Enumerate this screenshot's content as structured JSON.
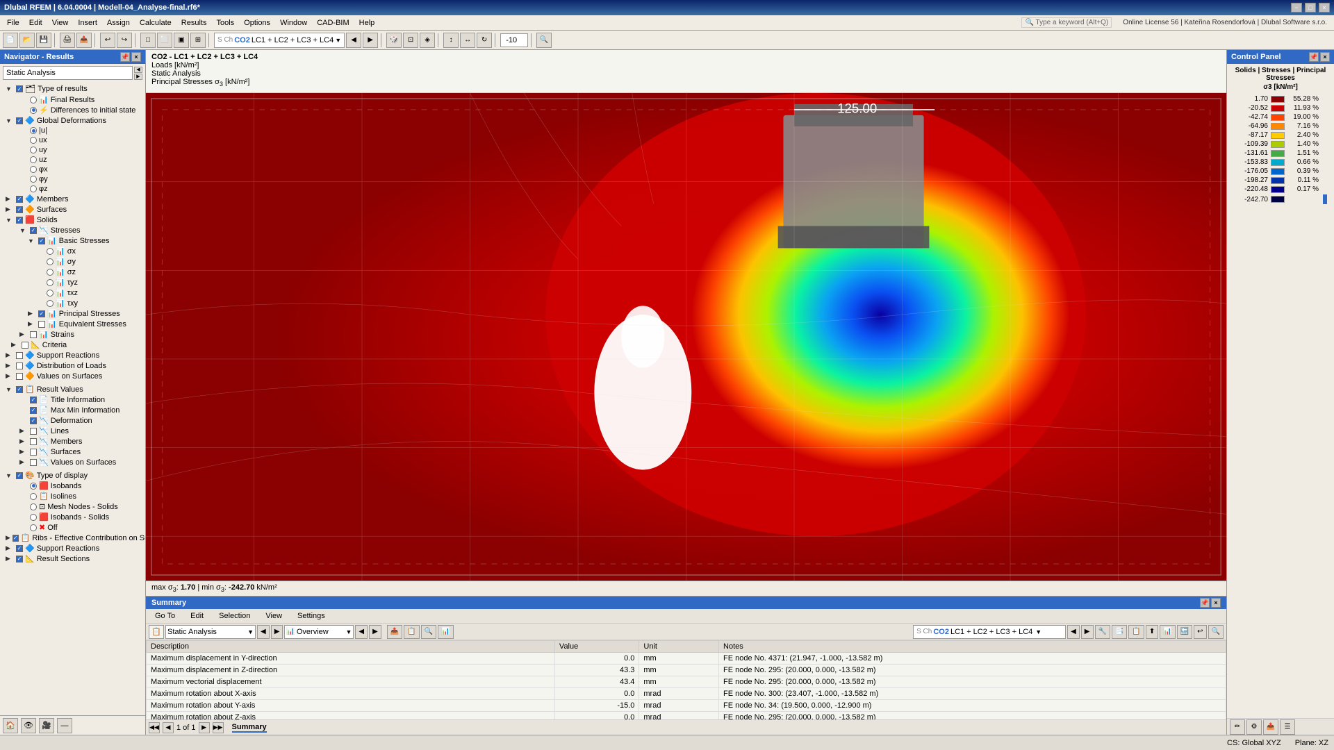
{
  "titlebar": {
    "title": "Dlubal RFEM | 6.04.0004 | Modell-04_Analyse-final.rf6*",
    "controls": [
      "−",
      "□",
      "×"
    ]
  },
  "menubar": {
    "items": [
      "File",
      "Edit",
      "View",
      "Insert",
      "Assign",
      "Calculate",
      "Results",
      "Tools",
      "Options",
      "Window",
      "CAD-BIM",
      "Help"
    ]
  },
  "navigator": {
    "title": "Navigator - Results",
    "combo": "Static Analysis",
    "tree": {
      "type_of_results": "Type of results",
      "final_results": "Final Results",
      "differences": "Differences to initial state",
      "global_deformations": "Global Deformations",
      "u": "|u|",
      "ux": "ux",
      "uy": "uy",
      "uz": "uz",
      "phi_x": "φx",
      "phi_y": "φy",
      "phi_z": "φz",
      "members": "Members",
      "surfaces": "Surfaces",
      "solids": "Solids",
      "stresses": "Stresses",
      "basic_stresses": "Basic Stresses",
      "sigma_x": "σx",
      "sigma_y": "σy",
      "sigma_z": "σz",
      "tau_yz": "τyz",
      "tau_xz": "τxz",
      "tau_xy": "τxy",
      "principal_stresses": "Principal Stresses",
      "equivalent_stresses": "Equivalent Stresses",
      "strains": "Strains",
      "criteria": "Criteria",
      "support_reactions": "Support Reactions",
      "distribution_of_loads": "Distribution of Loads",
      "values_on_surfaces": "Values on Surfaces",
      "result_values": "Result Values",
      "title_information": "Title Information",
      "max_min_information": "Max Min Information",
      "deformation": "Deformation",
      "lines": "Lines",
      "members2": "Members",
      "surfaces2": "Surfaces",
      "values_on_surfaces2": "Values on Surfaces",
      "type_of_display": "Type of display",
      "isobands": "Isobands",
      "isolines": "Isolines",
      "mesh_nodes_solids": "Mesh Nodes - Solids",
      "isobands_solids": "Isobands - Solids",
      "off": "Off",
      "ribs": "Ribs - Effective Contribution on Surfa...",
      "support_reactions2": "Support Reactions",
      "result_sections": "Result Sections"
    }
  },
  "infobar": {
    "line1": "CO2 - LC1 + LC2 + LC3 + LC4",
    "line2": "Loads [kN/m²]",
    "line3": "Static Analysis",
    "line4": "Principal Stresses σ3 [kN/m²]"
  },
  "viewport": {
    "max_label": "125.00"
  },
  "statusbar": {
    "text": "max σ3: 1.70 | min σ3: -242.70 kN/m²"
  },
  "control_panel": {
    "title": "Control Panel",
    "subtitle": "Solids | Stresses | Principal Stresses",
    "unit": "σ3 [kN/m²]",
    "legend": [
      {
        "value": "1.70",
        "pct": "55.28 %",
        "color": "#8b0000"
      },
      {
        "value": "-20.52",
        "pct": "11.93 %",
        "color": "#cc0000"
      },
      {
        "value": "-42.74",
        "pct": "19.00 %",
        "color": "#ff4400"
      },
      {
        "value": "-64.96",
        "pct": "7.16 %",
        "color": "#ff8800"
      },
      {
        "value": "-87.17",
        "pct": "2.40 %",
        "color": "#ffcc00"
      },
      {
        "value": "-109.39",
        "pct": "1.40 %",
        "color": "#aacc00"
      },
      {
        "value": "-131.61",
        "pct": "1.51 %",
        "color": "#44aa44"
      },
      {
        "value": "-153.83",
        "pct": "0.66 %",
        "color": "#00aacc"
      },
      {
        "value": "-176.05",
        "pct": "0.39 %",
        "color": "#0066cc"
      },
      {
        "value": "-198.27",
        "pct": "0.11 %",
        "color": "#0033aa"
      },
      {
        "value": "-220.48",
        "pct": "0.17 %",
        "color": "#000088"
      },
      {
        "value": "-242.70",
        "pct": "",
        "color": "#000044"
      }
    ]
  },
  "summary": {
    "title": "Summary",
    "tabs": [
      "Go To",
      "Edit",
      "Selection",
      "View",
      "Settings"
    ],
    "combo_analysis": "Static Analysis",
    "combo_overview": "Overview",
    "combo_lc": "S Ch  CO2   LC1 + LC2 + LC3 + LC4",
    "table": {
      "headers": [
        "Description",
        "Value",
        "Unit",
        "Notes"
      ],
      "rows": [
        {
          "desc": "Maximum displacement in Y-direction",
          "value": "0.0",
          "unit": "mm",
          "notes": "FE node No. 4371: (21.947, -1.000, -13.582 m)"
        },
        {
          "desc": "Maximum displacement in Z-direction",
          "value": "43.3",
          "unit": "mm",
          "notes": "FE node No. 295: (20.000, 0.000, -13.582 m)"
        },
        {
          "desc": "Maximum vectorial displacement",
          "value": "43.4",
          "unit": "mm",
          "notes": "FE node No. 295: (20.000, 0.000, -13.582 m)"
        },
        {
          "desc": "Maximum rotation about X-axis",
          "value": "0.0",
          "unit": "mrad",
          "notes": "FE node No. 300: (23.407, -1.000, -13.582 m)"
        },
        {
          "desc": "Maximum rotation about Y-axis",
          "value": "-15.0",
          "unit": "mrad",
          "notes": "FE node No. 34: (19.500, 0.000, -12.900 m)"
        },
        {
          "desc": "Maximum rotation about Z-axis",
          "value": "0.0",
          "unit": "mrad",
          "notes": "FE node No. 295: (20.000, 0.000, -13.582 m)"
        }
      ]
    },
    "page_info": "1 of 1",
    "tab_summary": "Summary"
  },
  "global_statusbar": {
    "cs": "CS: Global XYZ",
    "plane": "Plane: XZ"
  },
  "icons": {
    "expand": "▶",
    "collapse": "▼",
    "check": "✓",
    "dot": "●",
    "prev": "◀",
    "next": "▶",
    "first": "◀◀",
    "last": "▶▶",
    "close": "×",
    "pin": "📌",
    "minimize": "−",
    "maximize": "□"
  }
}
